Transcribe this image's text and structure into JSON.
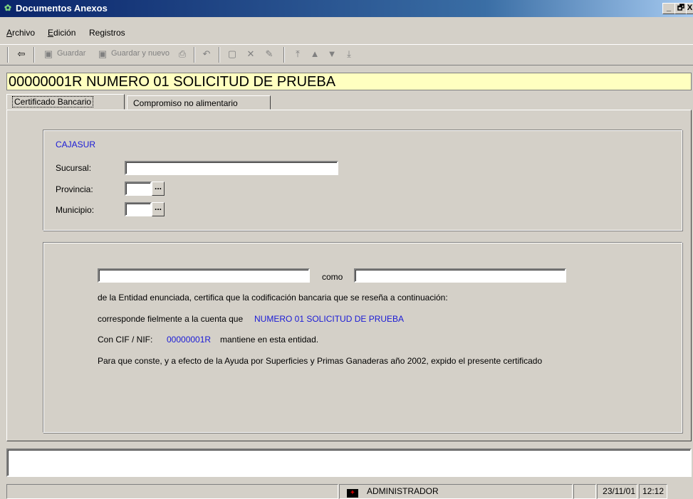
{
  "window": {
    "title": "Documentos Anexos",
    "controls": {
      "minimize": "_",
      "restore": "🗗",
      "close": "X"
    }
  },
  "menu": {
    "items": [
      {
        "underline": "A",
        "rest": "rchivo"
      },
      {
        "underline": "E",
        "rest": "dición"
      },
      {
        "underline": "",
        "rest": "Registros"
      }
    ]
  },
  "toolbar": {
    "back_icon": "⇦",
    "save_label": "Guardar",
    "save_new_label": "Guardar y nuevo"
  },
  "record": {
    "header": "00000001R NUMERO 01 SOLICITUD DE PRUEBA"
  },
  "tabs": [
    {
      "label": "Certificado Bancario"
    },
    {
      "label": "Compromiso no alimentario"
    }
  ],
  "bank": {
    "name": "CAJASUR",
    "sucursal_label": "Sucursal:",
    "sucursal_value": "",
    "provincia_label": "Provincia:",
    "provincia_value": "",
    "municipio_label": "Municipio:",
    "municipio_value": "",
    "lookup_glyph": "..."
  },
  "certificate": {
    "name_value": "",
    "como_label": "como",
    "role_value": "",
    "line1": "de la Entidad enunciada, certifica que la codificación bancaria que se reseña a continuación:",
    "line2_prefix": "corresponde fielmente a la cuenta que",
    "holder_name": "NUMERO 01 SOLICITUD DE PRUEBA",
    "line3_prefix": "Con CIF / NIF:",
    "nif_value": "00000001R",
    "line3_suffix": "mantiene en esta entidad.",
    "line4": "Para que conste, y a efecto de la Ayuda por Superficies y Primas Ganaderas año 2002, expido el presente certificado"
  },
  "status": {
    "user": "ADMINISTRADOR",
    "date": "23/11/01",
    "time": "12:12"
  }
}
